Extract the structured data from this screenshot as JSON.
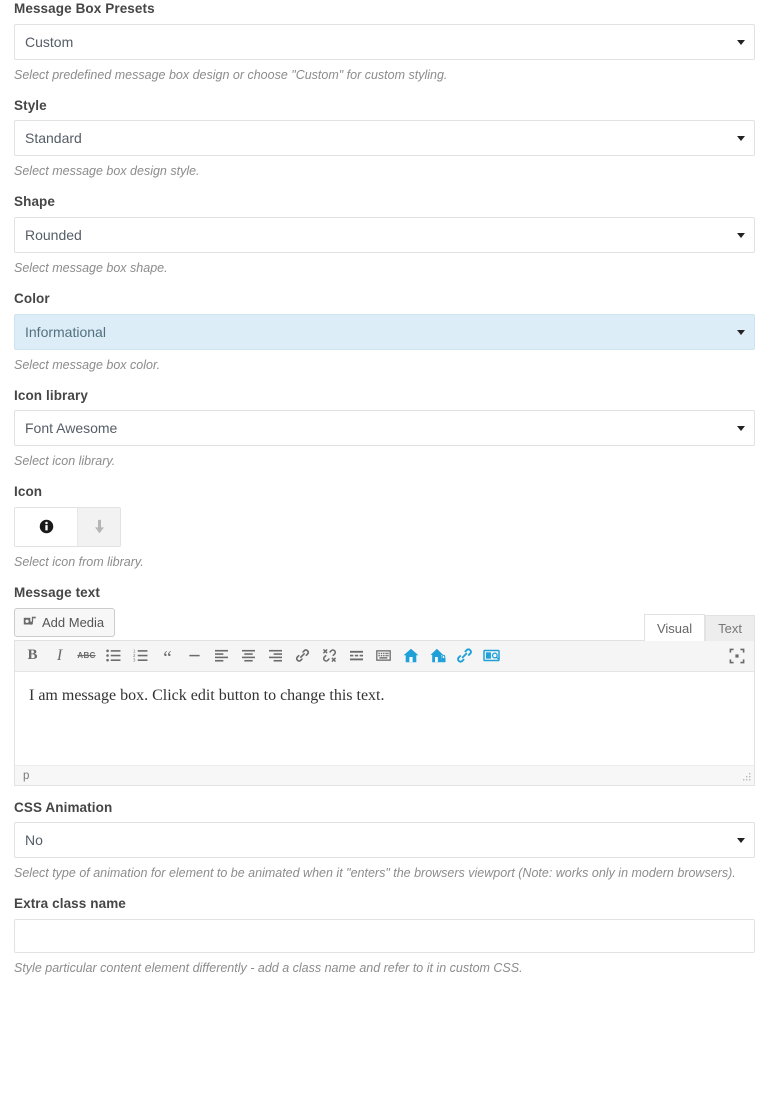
{
  "fields": {
    "presets": {
      "label": "Message Box Presets",
      "value": "Custom",
      "desc": "Select predefined message box design or choose \"Custom\" for custom styling."
    },
    "style": {
      "label": "Style",
      "value": "Standard",
      "desc": "Select message box design style."
    },
    "shape": {
      "label": "Shape",
      "value": "Rounded",
      "desc": "Select message box shape."
    },
    "color": {
      "label": "Color",
      "value": "Informational",
      "desc": "Select message box color.",
      "highlight_bg": "#dcedf8"
    },
    "icon_library": {
      "label": "Icon library",
      "value": "Font Awesome",
      "desc": "Select icon library."
    },
    "icon": {
      "label": "Icon",
      "desc": "Select icon from library.",
      "selected_icon": "info-circle-icon"
    },
    "message_text": {
      "label": "Message text",
      "add_media_label": "Add Media",
      "tabs": [
        {
          "label": "Visual",
          "active": true
        },
        {
          "label": "Text",
          "active": false
        }
      ],
      "content": "I am message box. Click edit button to change this text.",
      "status_path": "p",
      "toolbar": [
        {
          "name": "bold-icon",
          "glyph": "B",
          "kind": "bold-g",
          "accent": false
        },
        {
          "name": "italic-icon",
          "glyph": "I",
          "kind": "italic-g",
          "accent": false
        },
        {
          "name": "strikethrough-icon",
          "glyph": "ABC",
          "kind": "strike-g",
          "accent": false
        },
        {
          "name": "bulleted-list-icon",
          "glyph": "",
          "kind": "svg-ul",
          "accent": false
        },
        {
          "name": "numbered-list-icon",
          "glyph": "",
          "kind": "svg-ol",
          "accent": false
        },
        {
          "name": "blockquote-icon",
          "glyph": "“",
          "kind": "quote-g",
          "accent": false
        },
        {
          "name": "horizontal-rule-icon",
          "glyph": "",
          "kind": "svg-hr",
          "accent": false
        },
        {
          "name": "align-left-icon",
          "glyph": "",
          "kind": "svg-al",
          "accent": false
        },
        {
          "name": "align-center-icon",
          "glyph": "",
          "kind": "svg-ac",
          "accent": false
        },
        {
          "name": "align-right-icon",
          "glyph": "",
          "kind": "svg-ar",
          "accent": false
        },
        {
          "name": "insert-link-icon",
          "glyph": "",
          "kind": "svg-link",
          "accent": false
        },
        {
          "name": "remove-link-icon",
          "glyph": "",
          "kind": "svg-unlink",
          "accent": false
        },
        {
          "name": "read-more-icon",
          "glyph": "",
          "kind": "svg-more",
          "accent": false
        },
        {
          "name": "toolbar-toggle-icon",
          "glyph": "",
          "kind": "svg-kbd",
          "accent": false
        },
        {
          "name": "home-icon",
          "glyph": "",
          "kind": "svg-home",
          "accent": true
        },
        {
          "name": "home-lock-icon",
          "glyph": "",
          "kind": "svg-homelock",
          "accent": true
        },
        {
          "name": "chain-link-icon",
          "glyph": "",
          "kind": "svg-chain",
          "accent": true
        },
        {
          "name": "preview-panel-icon",
          "glyph": "",
          "kind": "svg-panel",
          "accent": true
        }
      ],
      "fullscreen_icon": "distraction-free-icon",
      "accent_color": "#20a0d8"
    },
    "css_animation": {
      "label": "CSS Animation",
      "value": "No",
      "desc": "Select type of animation for element to be animated when it \"enters\" the browsers viewport (Note: works only in modern browsers)."
    },
    "extra_class": {
      "label": "Extra class name",
      "value": "",
      "placeholder": "",
      "desc": "Style particular content element differently - add a class name and refer to it in custom CSS."
    }
  }
}
